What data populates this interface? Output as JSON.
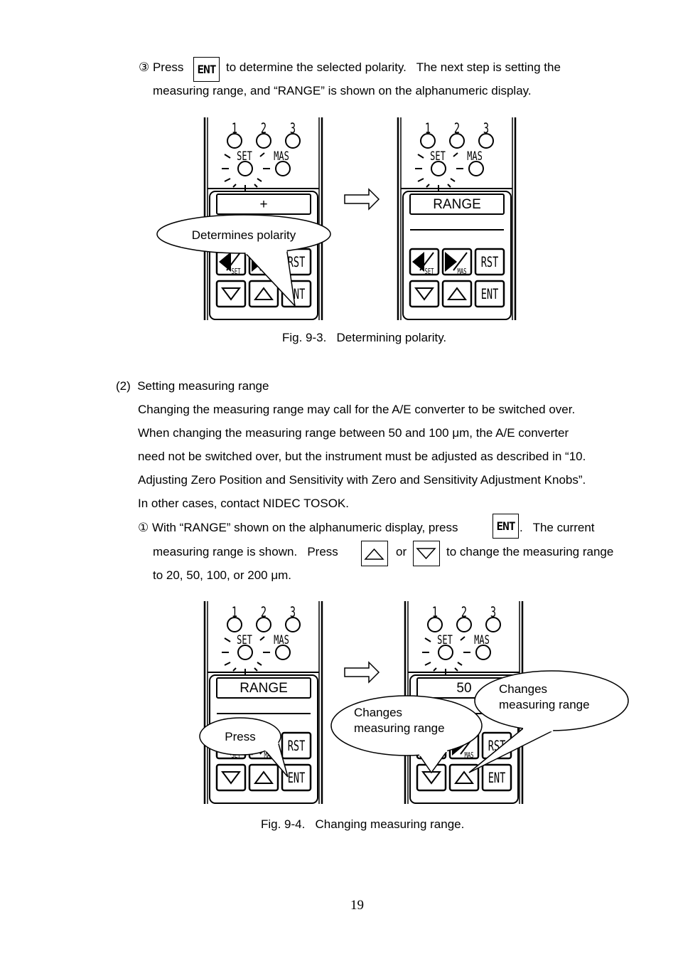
{
  "step3": {
    "marker": "③ Press",
    "key": "ENT",
    "text_a": "to determine the selected polarity.   The next step is setting the",
    "text_b": "measuring range, and “RANGE” is shown on the alphanumeric display."
  },
  "panel_labels": {
    "led1": "1",
    "led2": "2",
    "led3": "3",
    "set": "SET",
    "mas": "MAS",
    "rst": "RST",
    "ent": "ENT"
  },
  "fig93": {
    "left_display": "+",
    "right_display": "RANGE",
    "callout": "Determines polarity",
    "caption": "Fig. 9-3.   Determining polarity."
  },
  "section2": {
    "heading": "(2)  Setting measuring range",
    "para": [
      "Changing the measuring range may call for the A/E converter to be switched over.",
      "When changing the measuring range between 50 and 100 μm, the A/E converter",
      "need not be switched over, but the instrument must be adjusted as described in “10.",
      "Adjusting Zero Position and Sensitivity with Zero and Sensitivity Adjustment Knobs”.",
      "In other cases, contact NIDEC TOSOK."
    ],
    "step1_a": "① With “RANGE” shown on the alphanumeric display, press",
    "step1_key": "ENT",
    "step1_b": ".   The current",
    "step1_c": "measuring range is shown.   Press",
    "step1_or": "or",
    "step1_d": "to change the measuring range",
    "step1_e": "to 20, 50, 100, or 200 μm."
  },
  "fig94": {
    "left_display": "RANGE",
    "right_display": "50",
    "callout_press": "Press",
    "callout_change_1": "Changes",
    "callout_change_2": "measuring range",
    "caption": "Fig. 9-4.   Changing measuring range."
  },
  "page_number": "19"
}
